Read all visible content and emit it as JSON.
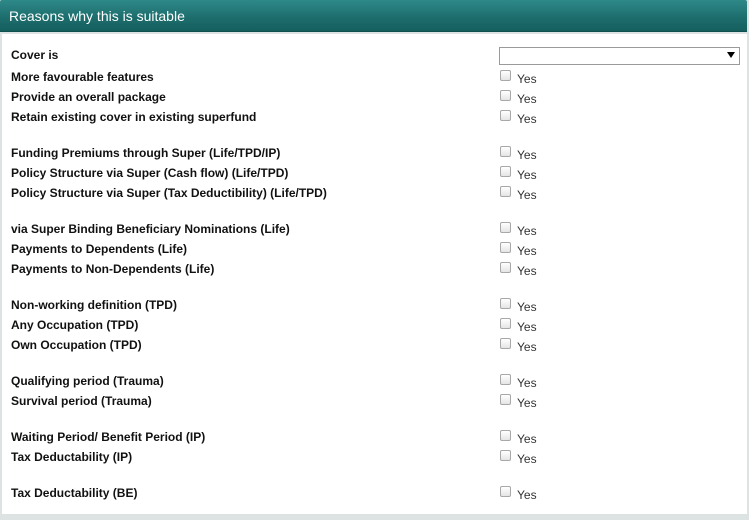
{
  "header": {
    "title": "Reasons why this is suitable"
  },
  "cover": {
    "label": "Cover is",
    "value": ""
  },
  "checkbox_label": "Yes",
  "rows": {
    "more_favourable_features": {
      "label": "More favourable features",
      "checked": false
    },
    "overall_package": {
      "label": "Provide an overall package",
      "checked": false
    },
    "retain_existing_cover": {
      "label": "Retain existing cover in existing superfund",
      "checked": false
    },
    "funding_premiums": {
      "label": "Funding Premiums through Super (Life/TPD/IP)",
      "checked": false
    },
    "cash_flow": {
      "label": "Policy Structure via Super (Cash flow) (Life/TPD)",
      "checked": false
    },
    "tax_deductibility_structure": {
      "label": "Policy Structure via Super (Tax Deductibility) (Life/TPD)",
      "checked": false
    },
    "binding_nominations": {
      "label": "via Super Binding Beneficiary Nominations (Life)",
      "checked": false
    },
    "payments_dependents": {
      "label": "Payments to Dependents (Life)",
      "checked": false
    },
    "payments_non_dependents": {
      "label": "Payments to Non-Dependents (Life)",
      "checked": false
    },
    "non_working_definition": {
      "label": "Non-working definition (TPD)",
      "checked": false
    },
    "any_occupation": {
      "label": "Any Occupation (TPD)",
      "checked": false
    },
    "own_occupation": {
      "label": "Own Occupation (TPD)",
      "checked": false
    },
    "qualifying_period": {
      "label": "Qualifying period (Trauma)",
      "checked": false
    },
    "survival_period": {
      "label": "Survival period (Trauma)",
      "checked": false
    },
    "waiting_benefit_period": {
      "label": "Waiting Period/ Benefit Period (IP)",
      "checked": false
    },
    "tax_deductability_ip": {
      "label": "Tax Deductability (IP)",
      "checked": false
    },
    "tax_deductability_be": {
      "label": "Tax Deductability (BE)",
      "checked": false
    }
  }
}
